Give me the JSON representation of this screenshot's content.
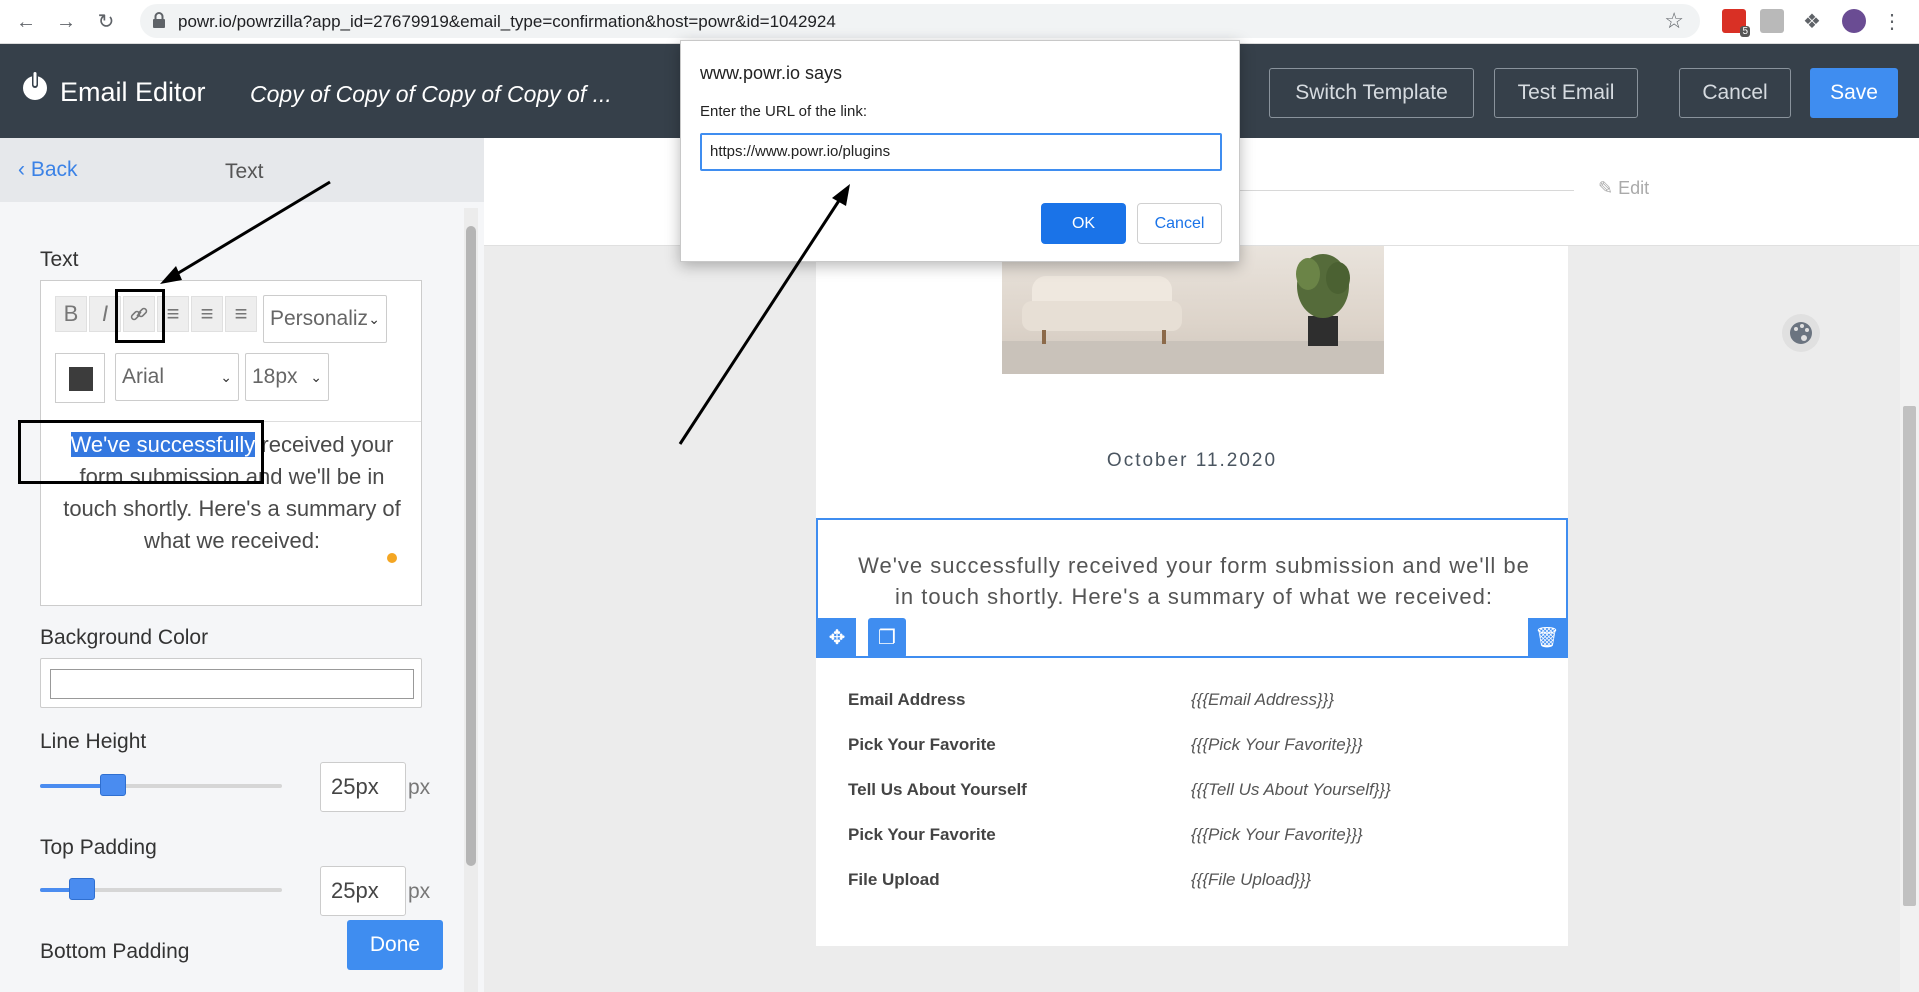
{
  "browser": {
    "url": "powr.io/powrzilla?app_id=27679919&email_type=confirmation&host=powr&id=1042924",
    "extension_badge": "5"
  },
  "header": {
    "app_title": "Email Editor",
    "doc_title": "Copy of Copy of Copy of Copy of ...",
    "switch_template": "Switch Template",
    "test_email": "Test Email",
    "cancel": "Cancel",
    "save": "Save"
  },
  "panel": {
    "back": "Back",
    "title": "Text",
    "text_label": "Text",
    "toolbar": {
      "bold": "B",
      "italic": "I",
      "personalize": "Personaliz",
      "font": "Arial",
      "size": "18px"
    },
    "editor": {
      "highlighted": "We've successfully",
      "rest": " received your form submission and we'll be in touch shortly. Here's a summary of what we received:"
    },
    "bg_color_label": "Background Color",
    "line_height_label": "Line Height",
    "line_height_value": "25px",
    "line_height_level": 0.25,
    "top_padding_label": "Top Padding",
    "top_padding_value": "25px",
    "top_padding_level": 0.14,
    "unit": "px",
    "bottom_padding_label": "Bottom Padding",
    "done": "Done"
  },
  "canvas": {
    "edit": "Edit",
    "date": "October 11.2020",
    "body_text": "We've successfully received your form submission and we'll be in touch shortly. Here's a summary of what we received:",
    "rows": [
      {
        "label": "Email Address",
        "value": "{{{Email Address}}}"
      },
      {
        "label": "Pick Your Favorite",
        "value": "{{{Pick Your Favorite}}}"
      },
      {
        "label": "Tell Us About Yourself",
        "value": "{{{Tell Us About Yourself}}}"
      },
      {
        "label": "Pick Your Favorite",
        "value": "{{{Pick Your Favorite}}}"
      },
      {
        "label": "File Upload",
        "value": "{{{File Upload}}}"
      }
    ]
  },
  "dialog": {
    "title": "www.powr.io says",
    "message": "Enter the URL of the link:",
    "input_value": "https://www.powr.io/plugins",
    "ok": "OK",
    "cancel": "Cancel"
  },
  "colors": {
    "accent": "#3f8df0",
    "header_bg": "#36404a",
    "selection": "#3478e0"
  }
}
